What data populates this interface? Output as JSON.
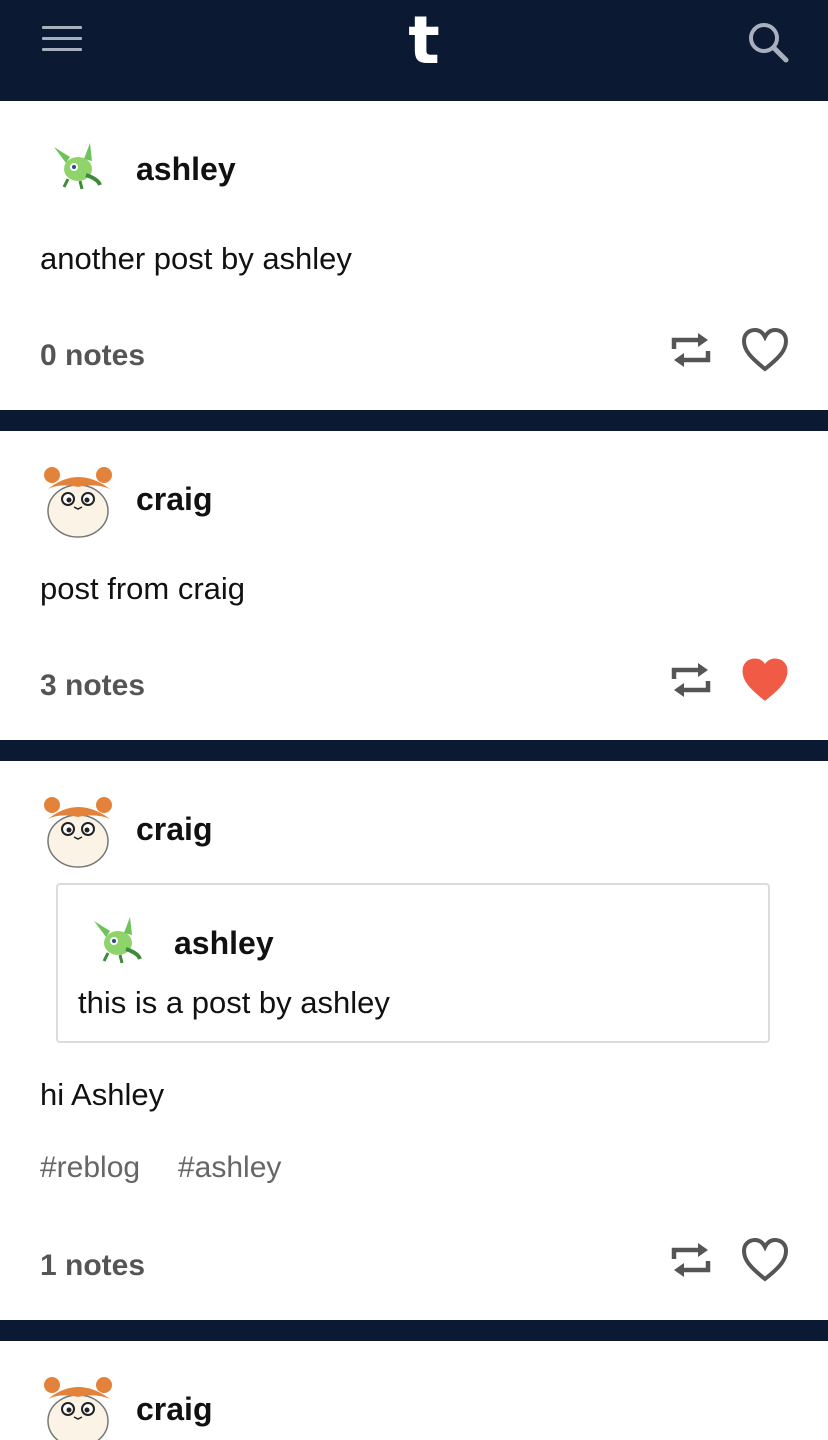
{
  "header": {
    "logo": "t",
    "menu_icon": "hamburger-menu-icon",
    "search_icon": "search-icon"
  },
  "colors": {
    "nav": "#0b1933",
    "like_active": "#ef5b45",
    "notes_text": "#555555"
  },
  "posts": [
    {
      "username": "ashley",
      "avatar": "green-pokemon-avatar",
      "body": "another post by ashley",
      "notes": "0 notes",
      "liked": false
    },
    {
      "username": "craig",
      "avatar": "hamster-avatar",
      "body": "post from craig",
      "notes": "3 notes",
      "liked": true
    },
    {
      "username": "craig",
      "avatar": "hamster-avatar",
      "reblog": {
        "username": "ashley",
        "avatar": "green-pokemon-avatar",
        "body": "this is a post by ashley"
      },
      "body": "hi Ashley",
      "tags": [
        "#reblog",
        "#ashley"
      ],
      "notes": "1 notes",
      "liked": false
    },
    {
      "username": "craig",
      "avatar": "hamster-avatar"
    }
  ]
}
